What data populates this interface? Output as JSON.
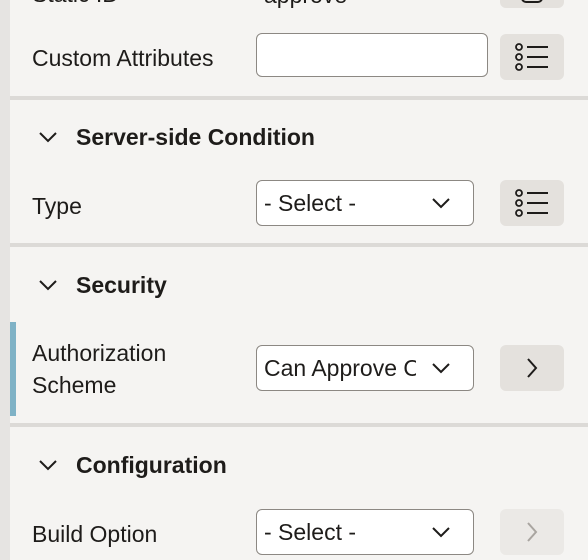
{
  "identification": {
    "static_id_label": "Static ID",
    "static_id_value": "approve"
  },
  "advanced": {
    "custom_attributes_label": "Custom Attributes",
    "custom_attributes_value": ""
  },
  "server_side_condition": {
    "title": "Server-side Condition",
    "type_label": "Type",
    "type_value": "- Select -"
  },
  "security": {
    "title": "Security",
    "authorization_label_line1": "Authorization",
    "authorization_label_line2": "Scheme",
    "authorization_value": "Can Approve Orders"
  },
  "configuration": {
    "title": "Configuration",
    "build_option_label": "Build Option",
    "build_option_value": "- Select -"
  },
  "icons": {
    "list": "list-icon",
    "chevron_down": "chevron-down-icon",
    "chevron_right": "chevron-right-icon"
  },
  "colors": {
    "accent": "#7fb2c6",
    "panel_bg": "#f5f4f2",
    "button_bg": "#e4e1dd"
  }
}
